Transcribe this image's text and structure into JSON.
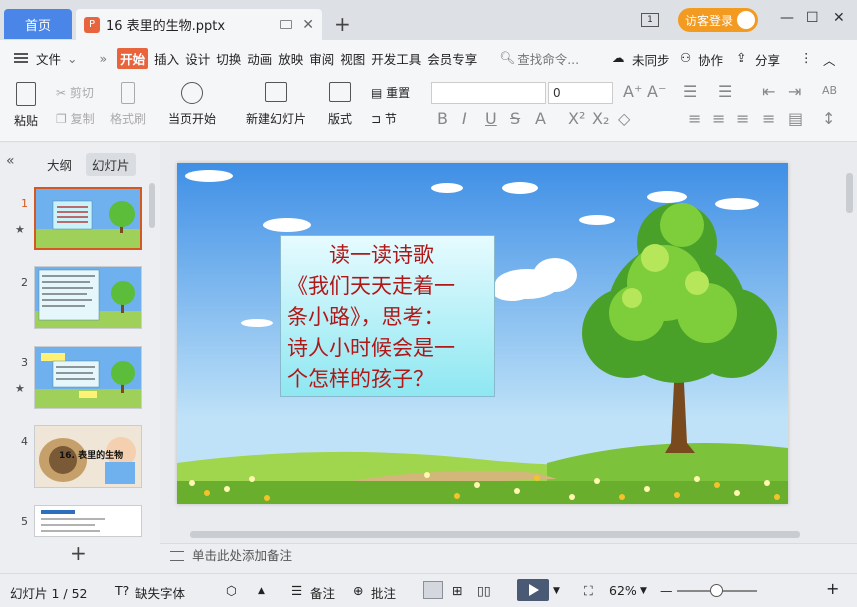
{
  "titlebar": {
    "home_tab": "首页",
    "doc_tab": "16 表里的生物.pptx",
    "page_indicator": "1",
    "login": "访客登录"
  },
  "menu": {
    "file": "文件",
    "items": [
      "开始",
      "插入",
      "设计",
      "切换",
      "动画",
      "放映",
      "审阅",
      "视图",
      "开发工具",
      "会员专享"
    ],
    "search_placeholder": "查找命令...",
    "sync": "未同步",
    "collab": "协作",
    "share": "分享"
  },
  "ribbon": {
    "paste": "粘贴",
    "cut": "剪切",
    "copy": "复制",
    "format_painter": "格式刷",
    "start_from_current": "当页开始",
    "new_slide": "新建幻灯片",
    "layout": "版式",
    "reset": "重置",
    "section": "节",
    "font_size": "0"
  },
  "left_panel": {
    "tab_outline": "大纲",
    "tab_slides": "幻灯片",
    "slides": [
      {
        "num": "1",
        "star": true,
        "selected": true
      },
      {
        "num": "2",
        "star": false,
        "selected": false
      },
      {
        "num": "3",
        "star": true,
        "selected": false
      },
      {
        "num": "4",
        "star": false,
        "selected": false,
        "caption": "16. 表里的生物"
      },
      {
        "num": "5",
        "star": false,
        "selected": false
      }
    ]
  },
  "slide": {
    "lines": [
      "　　读一读诗歌",
      "《我们天天走着一",
      "条小路》，思考：",
      "诗人小时候会是一",
      "个怎样的孩子？"
    ]
  },
  "notes": {
    "placeholder": "单击此处添加备注"
  },
  "status": {
    "slide_counter": "幻灯片 1 / 52",
    "missing_fonts": "缺失字体",
    "notes_btn": "备注",
    "comments_btn": "批注",
    "zoom": "62%"
  },
  "colors": {
    "accent": "#e8643d",
    "home_tab": "#4a86e8",
    "login": "#f39a21",
    "slide_text": "#b01818"
  }
}
